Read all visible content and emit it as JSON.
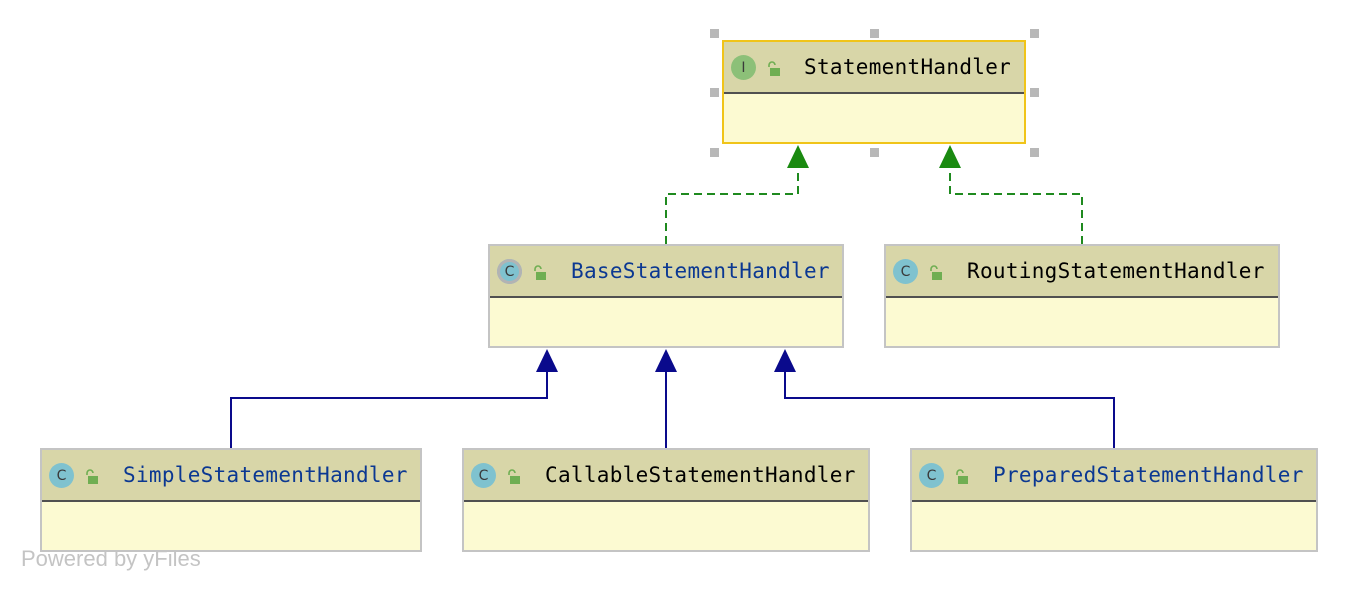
{
  "nodes": {
    "statement_handler": {
      "name": "StatementHandler",
      "kind": "I",
      "kind_type": "interface"
    },
    "base_statement_handler": {
      "name": "BaseStatementHandler",
      "kind": "C",
      "kind_type": "abstract-class"
    },
    "routing_statement_handler": {
      "name": "RoutingStatementHandler",
      "kind": "C",
      "kind_type": "class"
    },
    "simple_statement_handler": {
      "name": "SimpleStatementHandler",
      "kind": "C",
      "kind_type": "class"
    },
    "callable_statement_handler": {
      "name": "CallableStatementHandler",
      "kind": "C",
      "kind_type": "class"
    },
    "prepared_statement_handler": {
      "name": "PreparedStatementHandler",
      "kind": "C",
      "kind_type": "class"
    }
  },
  "edges": [
    {
      "from": "BaseStatementHandler",
      "to": "StatementHandler",
      "type": "implements"
    },
    {
      "from": "RoutingStatementHandler",
      "to": "StatementHandler",
      "type": "implements"
    },
    {
      "from": "SimpleStatementHandler",
      "to": "BaseStatementHandler",
      "type": "extends"
    },
    {
      "from": "CallableStatementHandler",
      "to": "BaseStatementHandler",
      "type": "extends"
    },
    {
      "from": "PreparedStatementHandler",
      "to": "BaseStatementHandler",
      "type": "extends"
    }
  ],
  "selected_node": "StatementHandler",
  "colors": {
    "implements_edge": "#1f8a1f",
    "extends_edge": "#0a0a8c",
    "selection_border": "#f0c419",
    "header_bg": "#d8d6a8",
    "body_bg": "#fcfad2",
    "interface_icon": "#8cc078",
    "class_icon": "#7fc2cf",
    "lock_icon": "#6fae52"
  },
  "watermark": "Powered by yFiles"
}
